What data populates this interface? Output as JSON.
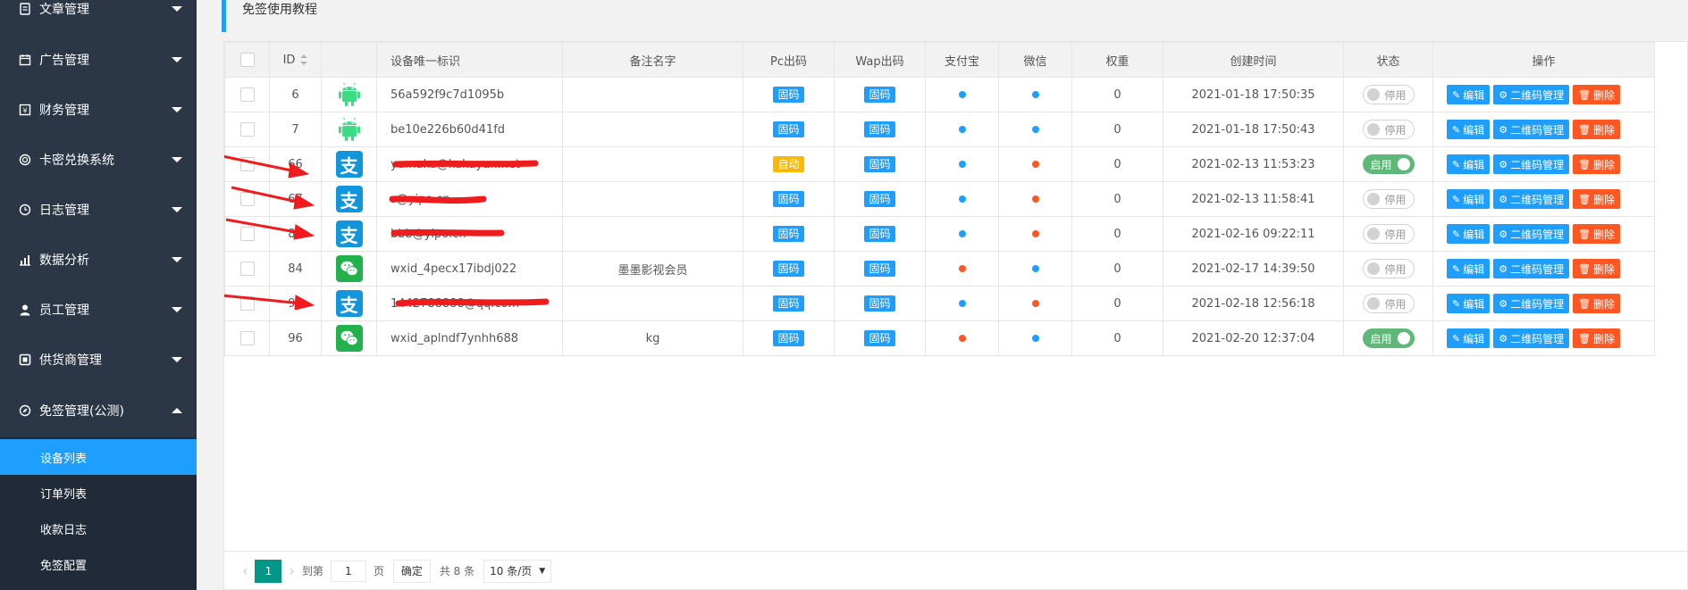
{
  "colors": {
    "sidebar_bg": "#2b3646",
    "submenu_bg": "#202a38",
    "active": "#1e9fff",
    "blue": "#1e9fff",
    "orange_red": "#ff5722",
    "yellow": "#ffb800",
    "green": "#5fb878",
    "teal": "#009688"
  },
  "sidebar": {
    "items": [
      {
        "label": "文章管理",
        "icon": "document-icon"
      },
      {
        "label": "广告管理",
        "icon": "calendar-icon"
      },
      {
        "label": "财务管理",
        "icon": "finance-icon"
      },
      {
        "label": "卡密兑换系统",
        "icon": "target-icon"
      },
      {
        "label": "日志管理",
        "icon": "clock-icon"
      },
      {
        "label": "数据分析",
        "icon": "chart-icon"
      },
      {
        "label": "员工管理",
        "icon": "user-icon"
      },
      {
        "label": "供货商管理",
        "icon": "box-icon"
      },
      {
        "label": "免签管理(公测)",
        "icon": "compass-icon"
      }
    ],
    "subitems": [
      {
        "label": "设备列表",
        "active": true
      },
      {
        "label": "订单列表",
        "active": false
      },
      {
        "label": "收款日志",
        "active": false
      },
      {
        "label": "免签配置",
        "active": false
      }
    ]
  },
  "notice": {
    "text": "免签使用教程"
  },
  "table": {
    "headers": [
      "ID",
      "设备唯一标识",
      "备注名字",
      "Pc出码",
      "Wap出码",
      "支付宝",
      "微信",
      "权重",
      "创建时间",
      "状态",
      "操作"
    ],
    "rows": [
      {
        "id": "6",
        "type": "android",
        "device": "56a592f9c7d1095b",
        "remark": "",
        "pc": "固码",
        "pc_color": "#1e9fff",
        "wap": "固码",
        "alipay_color": "#1e9fff",
        "wechat_color": "#1e9fff",
        "weight": "0",
        "created": "2021-01-18 17:50:35",
        "status": "停用",
        "on": false
      },
      {
        "id": "7",
        "type": "android",
        "device": "be10e226b60d41fd",
        "remark": "",
        "pc": "固码",
        "pc_color": "#1e9fff",
        "wap": "固码",
        "alipay_color": "#1e9fff",
        "wechat_color": "#1e9fff",
        "weight": "0",
        "created": "2021-01-18 17:50:43",
        "status": "停用",
        "on": false
      },
      {
        "id": "66",
        "type": "alipay",
        "device": "yumaka@kakayun.net",
        "remark": "",
        "pc": "自动",
        "pc_color": "#ffb800",
        "wap": "固码",
        "alipay_color": "#1e9fff",
        "wechat_color": "#ff5722",
        "weight": "0",
        "created": "2021-02-13 11:53:23",
        "status": "启用",
        "on": true
      },
      {
        "id": "67",
        "type": "alipay",
        "device": "s@yipo.cn",
        "remark": "",
        "pc": "固码",
        "pc_color": "#1e9fff",
        "wap": "固码",
        "alipay_color": "#1e9fff",
        "wechat_color": "#ff5722",
        "weight": "0",
        "created": "2021-02-13 11:58:41",
        "status": "停用",
        "on": false
      },
      {
        "id": "80",
        "type": "alipay",
        "device": "bbb@yipo.cn",
        "remark": "",
        "pc": "固码",
        "pc_color": "#1e9fff",
        "wap": "固码",
        "alipay_color": "#1e9fff",
        "wechat_color": "#ff5722",
        "weight": "0",
        "created": "2021-02-16 09:22:11",
        "status": "停用",
        "on": false
      },
      {
        "id": "84",
        "type": "wechat",
        "device": "wxid_4pecx17ibdj022",
        "remark": "墨墨影视会员",
        "pc": "固码",
        "pc_color": "#1e9fff",
        "wap": "固码",
        "alipay_color": "#ff5722",
        "wechat_color": "#1e9fff",
        "weight": "0",
        "created": "2021-02-17 14:39:50",
        "status": "停用",
        "on": false
      },
      {
        "id": "92",
        "type": "alipay",
        "device": "1442788888@qq.com",
        "remark": "",
        "pc": "固码",
        "pc_color": "#1e9fff",
        "wap": "固码",
        "alipay_color": "#1e9fff",
        "wechat_color": "#ff5722",
        "weight": "0",
        "created": "2021-02-18 12:56:18",
        "status": "停用",
        "on": false
      },
      {
        "id": "96",
        "type": "wechat",
        "device": "wxid_aplndf7ynhh688",
        "remark": "kg",
        "pc": "固码",
        "pc_color": "#1e9fff",
        "wap": "固码",
        "alipay_color": "#ff5722",
        "wechat_color": "#1e9fff",
        "weight": "0",
        "created": "2021-02-20 12:37:04",
        "status": "启用",
        "on": true
      }
    ],
    "actions": {
      "edit": "编辑",
      "qrcode": "二维码管理",
      "delete": "删除"
    }
  },
  "pager": {
    "current": "1",
    "goto_label": "到第",
    "goto_value": "1",
    "page_unit": "页",
    "confirm": "确定",
    "total": "共 8 条",
    "page_size": "10 条/页"
  }
}
